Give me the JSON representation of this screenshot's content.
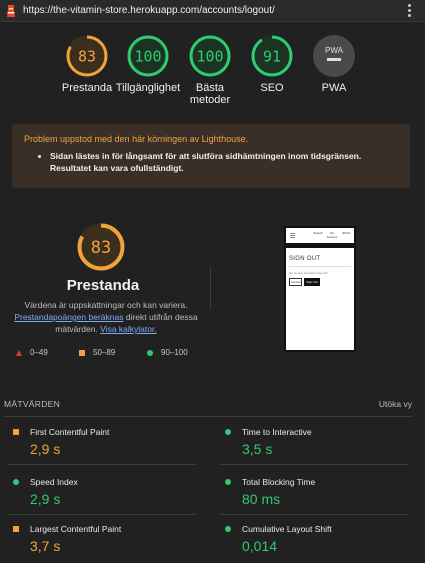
{
  "topbar": {
    "url": "https://the-vitamin-store.herokuapp.com/accounts/logout/"
  },
  "gauges": [
    {
      "score": "83",
      "label": "Prestanda",
      "level": "average",
      "fraction": 0.83,
      "color": "#f3a33b"
    },
    {
      "score": "100",
      "label": "Tillgänglighet",
      "level": "pass",
      "fraction": 1.0,
      "color": "#2ecc71"
    },
    {
      "score": "100",
      "label": "Bästa metoder",
      "level": "pass",
      "fraction": 1.0,
      "color": "#2ecc71"
    },
    {
      "score": "91",
      "label": "SEO",
      "level": "pass",
      "fraction": 0.91,
      "color": "#2ecc71"
    },
    {
      "badge": "PWA",
      "label": "PWA"
    }
  ],
  "warning": {
    "title": "Problem uppstod med den här körningen av Lighthouse.",
    "items": [
      "Sidan lästes in för långsamt för att slutföra sidhämtningen inom tidsgränsen. Resultatet kan vara ofullständigt."
    ]
  },
  "performance": {
    "score": "83",
    "fraction": 0.83,
    "title": "Prestanda",
    "desc_1": "Värdena är uppskattningar och kan variera.",
    "desc_link_1": "Prestandapoängen beräknas",
    "desc_2": " direkt utifrån dessa mätvärden.",
    "desc_link_2": "Visa kalkylator."
  },
  "legend": [
    {
      "shape": "triangle",
      "label": "0–49",
      "color": "#e53935"
    },
    {
      "shape": "square",
      "label": "50–89",
      "color": "#f3a33b"
    },
    {
      "shape": "circle",
      "label": "90–100",
      "color": "#2ecc71"
    }
  ],
  "thumbnail": {
    "nav_items": [
      "Search",
      "My Account",
      "$0.00"
    ],
    "heading": "SIGN OUT",
    "text": "Are you sure you want to sign out?",
    "cancel": "Cancel",
    "signout": "Sign Out"
  },
  "metrics_header": {
    "title": "MÄTVÄRDEN",
    "expand": "Utöka vy"
  },
  "metrics": [
    {
      "label": "First Contentful Paint",
      "value": "2,9 s",
      "status": "average"
    },
    {
      "label": "Time to Interactive",
      "value": "3,5 s",
      "status": "pass"
    },
    {
      "label": "Speed Index",
      "value": "2,9 s",
      "status": "pass"
    },
    {
      "label": "Total Blocking Time",
      "value": "80 ms",
      "status": "pass"
    },
    {
      "label": "Largest Contentful Paint",
      "value": "3,7 s",
      "status": "average"
    },
    {
      "label": "Cumulative Layout Shift",
      "value": "0,014",
      "status": "pass"
    }
  ],
  "colors": {
    "average": "#f3a33b",
    "pass": "#2ecc71",
    "fail": "#e53935",
    "background": "#212121"
  }
}
